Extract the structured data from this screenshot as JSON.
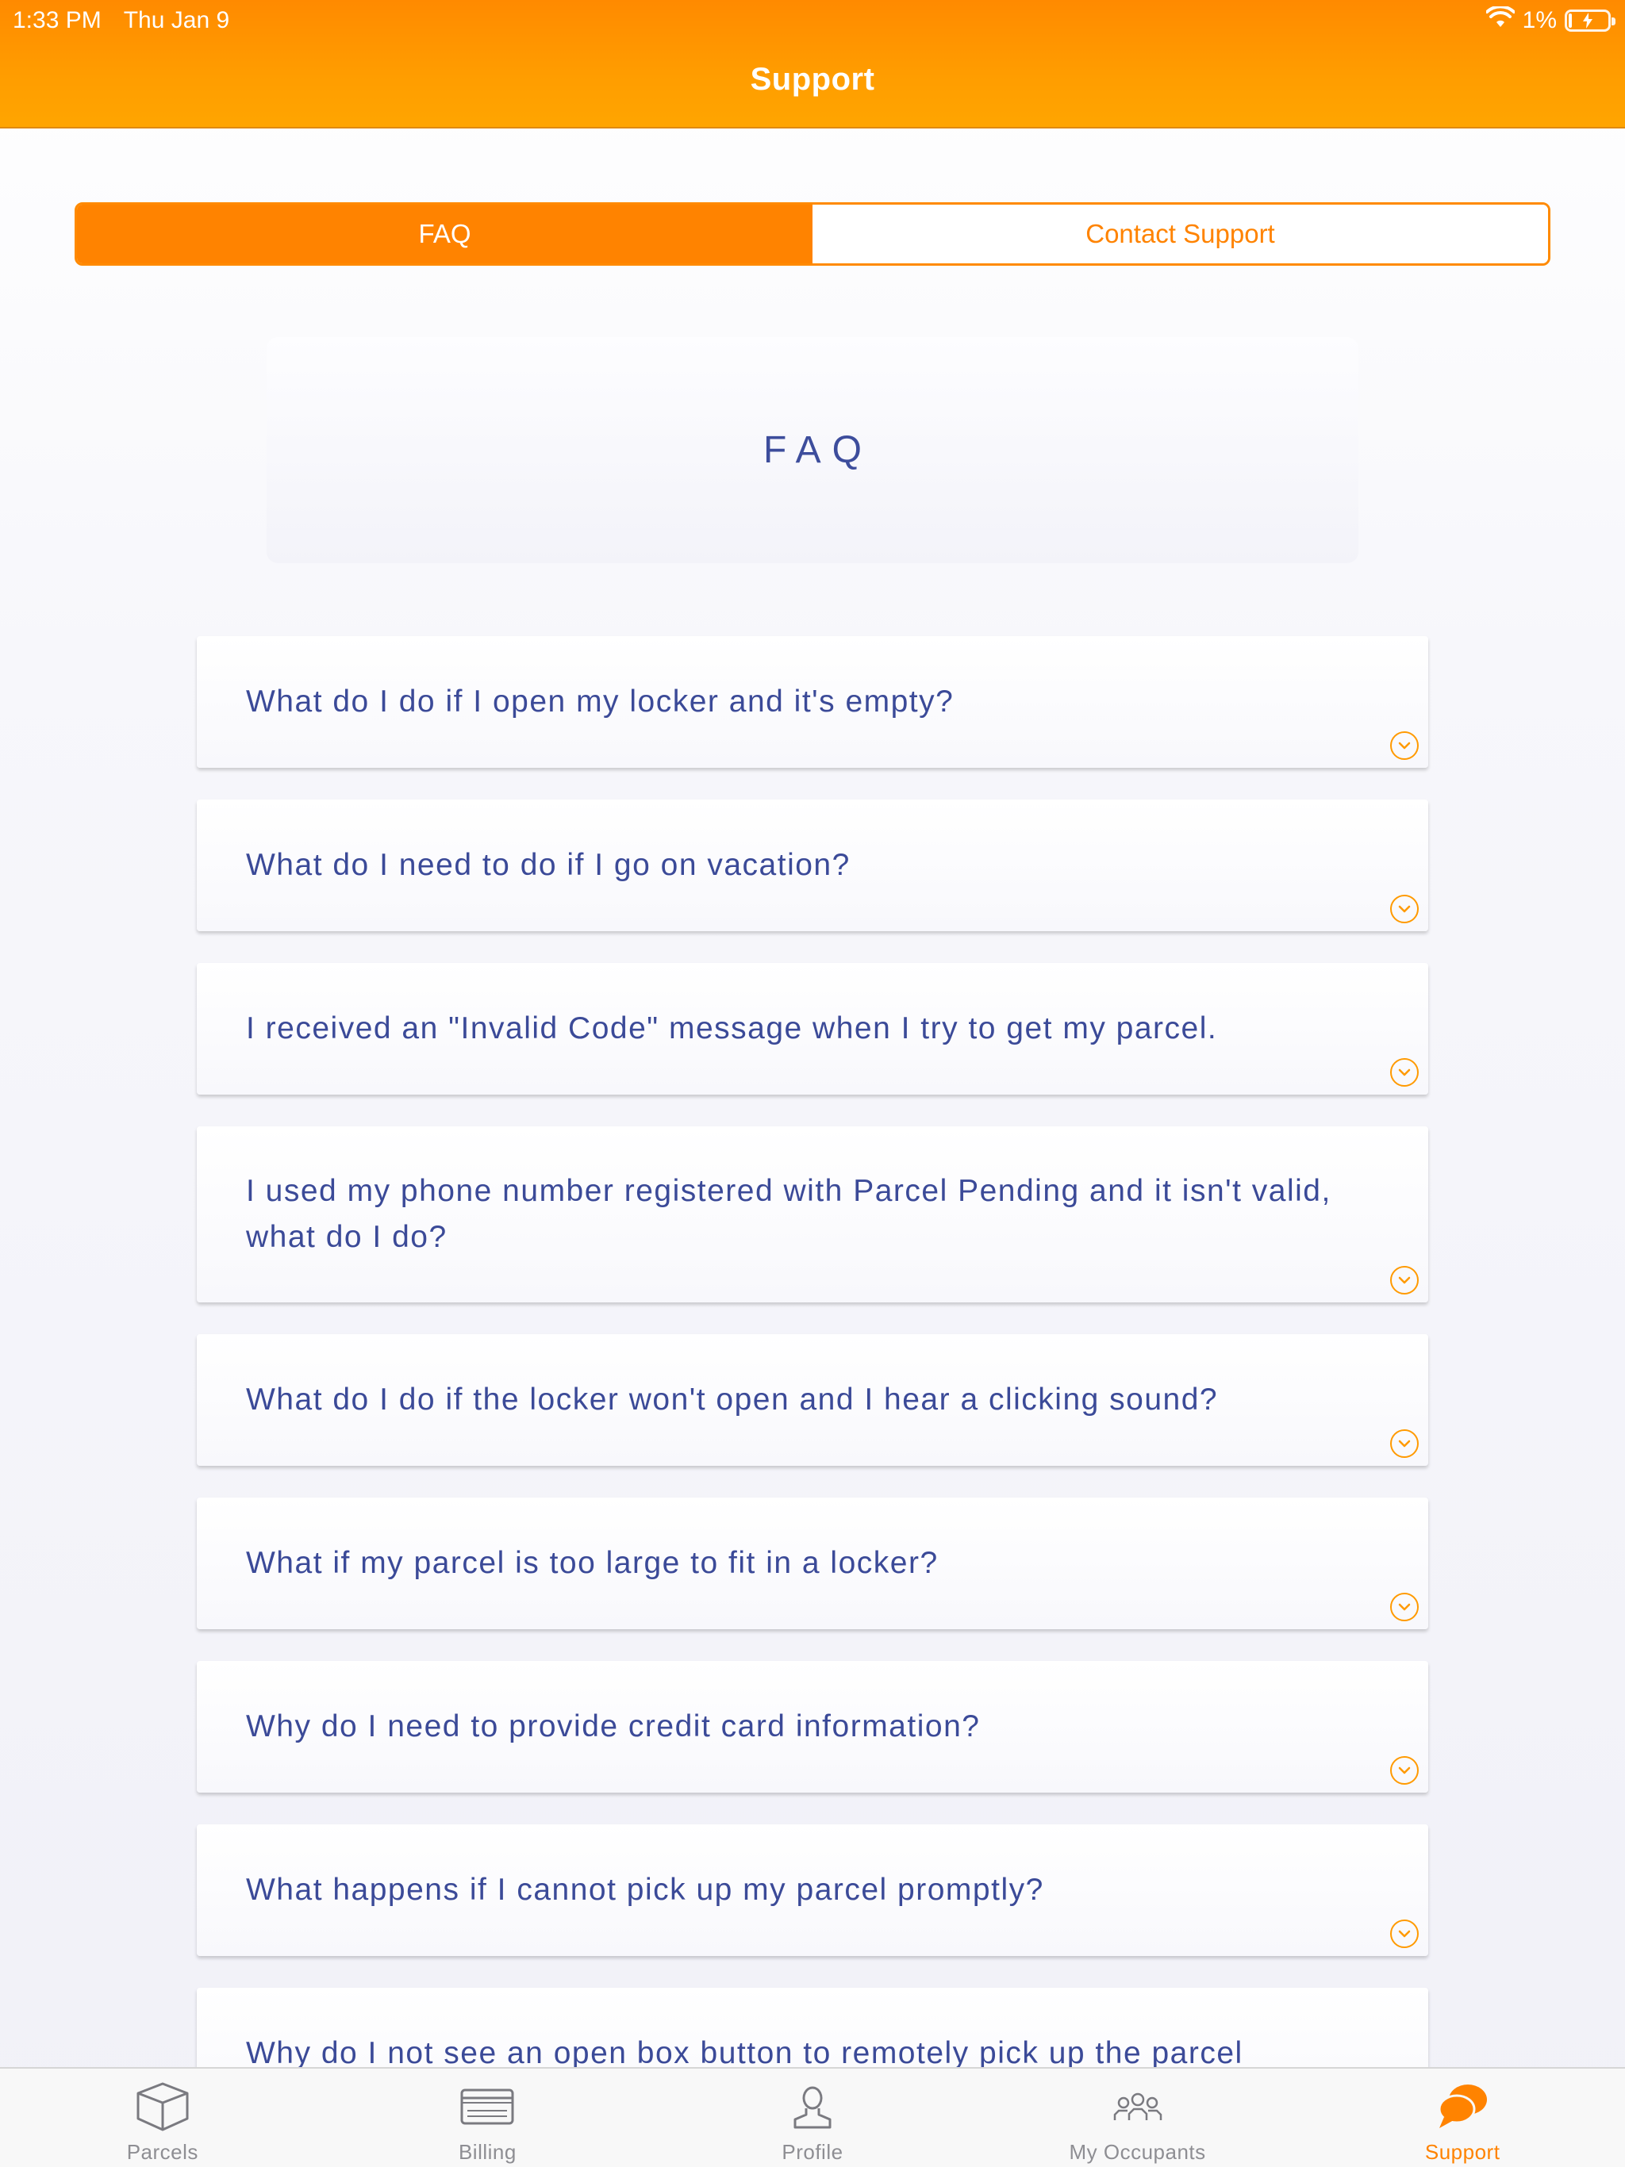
{
  "status_bar": {
    "time": "1:33 PM",
    "date": "Thu Jan 9",
    "battery": "1%",
    "icons": [
      "wifi-icon",
      "battery-charging-icon"
    ]
  },
  "header": {
    "title": "Support"
  },
  "segments": [
    {
      "label": "FAQ",
      "selected": true
    },
    {
      "label": "Contact Support",
      "selected": false
    }
  ],
  "faq_heading": "FAQ",
  "faq_items": [
    {
      "question": "What do I do if I open my locker and it's empty?"
    },
    {
      "question": "What do I need to do if I go on vacation?"
    },
    {
      "question": "I received an \"Invalid Code\" message when I try to get my parcel."
    },
    {
      "question": "I used my phone number registered with Parcel Pending and it isn't valid, what do I do?"
    },
    {
      "question": "What do I do if the locker won't open and I hear a clicking sound?"
    },
    {
      "question": "What if my parcel is too large to fit in a locker?"
    },
    {
      "question": "Why do I need to provide credit card information?"
    },
    {
      "question": "What happens if I cannot pick up my parcel promptly?"
    },
    {
      "question": "Why do I not see an open box button to remotely pick up the parcel"
    }
  ],
  "tabs": [
    {
      "label": "Parcels",
      "icon": "box-icon",
      "active": false
    },
    {
      "label": "Billing",
      "icon": "credit-card-icon",
      "active": false
    },
    {
      "label": "Profile",
      "icon": "person-icon",
      "active": false
    },
    {
      "label": "My Occupants",
      "icon": "group-icon",
      "active": false
    },
    {
      "label": "Support",
      "icon": "chat-bubble-icon",
      "active": true
    }
  ],
  "colors": {
    "accent": "#ff8300",
    "header_gradient_start": "#ff8a00",
    "header_gradient_end": "#ffa500",
    "text_primary": "#3b4a98",
    "tab_inactive": "#8e8e93"
  }
}
